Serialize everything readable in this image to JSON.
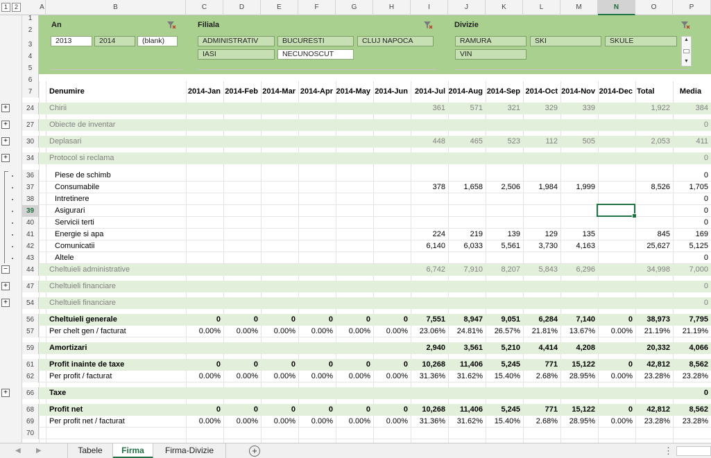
{
  "outline_levels": [
    "1",
    "2"
  ],
  "columns": [
    "A",
    "B",
    "C",
    "D",
    "E",
    "F",
    "G",
    "H",
    "I",
    "J",
    "K",
    "L",
    "M",
    "N",
    "O",
    "P"
  ],
  "selected_column": "N",
  "selected_row": "39",
  "slicers": {
    "an": {
      "title": "An",
      "items": [
        {
          "label": "2013",
          "on": true
        },
        {
          "label": "2014",
          "on": false
        },
        {
          "label": "(blank)",
          "on": true
        }
      ]
    },
    "filiala": {
      "title": "Filiala",
      "items": [
        {
          "label": "ADMINISTRATIV",
          "on": false
        },
        {
          "label": "BUCURESTI",
          "on": false
        },
        {
          "label": "CLUJ NAPOCA",
          "on": false
        },
        {
          "label": "IASI",
          "on": false
        },
        {
          "label": "NECUNOSCUT",
          "on": true
        }
      ]
    },
    "divizie": {
      "title": "Divizie",
      "items": [
        {
          "label": "RAMURA",
          "on": false
        },
        {
          "label": "SKI",
          "on": false
        },
        {
          "label": "SKULE",
          "on": false
        },
        {
          "label": "VIN",
          "on": false
        }
      ]
    }
  },
  "header": {
    "row": "7",
    "label": "Denumire",
    "months": [
      "2014-Jan",
      "2014-Feb",
      "2014-Mar",
      "2014-Apr",
      "2014-May",
      "2014-Jun",
      "2014-Jul",
      "2014-Aug",
      "2014-Sep",
      "2014-Oct",
      "2014-Nov",
      "2014-Dec"
    ],
    "total": "Total",
    "media": "Media"
  },
  "rows": [
    {
      "row": "24",
      "label": "Chirii",
      "type": "group",
      "plus": "+",
      "vals": [
        "",
        "",
        "",
        "",
        "",
        "",
        "361",
        "571",
        "321",
        "329",
        "339",
        "",
        "1,922",
        "384"
      ]
    },
    {
      "row": "27",
      "label": "Obiecte de inventar",
      "type": "group",
      "plus": "+",
      "vals": [
        "",
        "",
        "",
        "",
        "",
        "",
        "",
        "",
        "",
        "",
        "",
        "",
        "",
        "0"
      ]
    },
    {
      "row": "30",
      "label": "Deplasari",
      "type": "group",
      "plus": "+",
      "vals": [
        "",
        "",
        "",
        "",
        "",
        "",
        "448",
        "465",
        "523",
        "112",
        "505",
        "",
        "2,053",
        "411"
      ]
    },
    {
      "row": "34",
      "label": "Protocol si reclama",
      "type": "group",
      "plus": "+",
      "vals": [
        "",
        "",
        "",
        "",
        "",
        "",
        "",
        "",
        "",
        "",
        "",
        "",
        "",
        "0"
      ]
    },
    {
      "row": "36",
      "label": "Piese de schimb",
      "type": "sub",
      "vals": [
        "",
        "",
        "",
        "",
        "",
        "",
        "",
        "",
        "",
        "",
        "",
        "",
        "",
        "0"
      ]
    },
    {
      "row": "37",
      "label": "Consumabile",
      "type": "sub",
      "vals": [
        "",
        "",
        "",
        "",
        "",
        "",
        "378",
        "1,658",
        "2,506",
        "1,984",
        "1,999",
        "",
        "8,526",
        "1,705"
      ]
    },
    {
      "row": "38",
      "label": "Intretinere",
      "type": "sub",
      "vals": [
        "",
        "",
        "",
        "",
        "",
        "",
        "",
        "",
        "",
        "",
        "",
        "",
        "",
        "0"
      ]
    },
    {
      "row": "39",
      "label": "Asigurari",
      "type": "sub",
      "vals": [
        "",
        "",
        "",
        "",
        "",
        "",
        "",
        "",
        "",
        "",
        "",
        "",
        "",
        "0"
      ]
    },
    {
      "row": "40",
      "label": "Servicii terti",
      "type": "sub",
      "vals": [
        "",
        "",
        "",
        "",
        "",
        "",
        "",
        "",
        "",
        "",
        "",
        "",
        "",
        "0"
      ]
    },
    {
      "row": "41",
      "label": "Energie si apa",
      "type": "sub",
      "vals": [
        "",
        "",
        "",
        "",
        "",
        "",
        "224",
        "219",
        "139",
        "129",
        "135",
        "",
        "845",
        "169"
      ]
    },
    {
      "row": "42",
      "label": "Comunicatii",
      "type": "sub",
      "vals": [
        "",
        "",
        "",
        "",
        "",
        "",
        "6,140",
        "6,033",
        "5,561",
        "3,730",
        "4,163",
        "",
        "25,627",
        "5,125"
      ]
    },
    {
      "row": "43",
      "label": "Altele",
      "type": "sub",
      "vals": [
        "",
        "",
        "",
        "",
        "",
        "",
        "",
        "",
        "",
        "",
        "",
        "",
        "",
        "0"
      ]
    },
    {
      "row": "44",
      "label": "Cheltuieli administrative",
      "type": "group",
      "plus": "−",
      "vals": [
        "",
        "",
        "",
        "",
        "",
        "",
        "6,742",
        "7,910",
        "8,207",
        "5,843",
        "6,296",
        "",
        "34,998",
        "7,000"
      ]
    },
    {
      "row": "47",
      "label": "Cheltuieli financiare",
      "type": "group",
      "plus": "+",
      "vals": [
        "",
        "",
        "",
        "",
        "",
        "",
        "",
        "",
        "",
        "",
        "",
        "",
        "",
        "0"
      ]
    },
    {
      "row": "54",
      "label": "Cheltuieli financiare",
      "type": "group",
      "plus": "+",
      "vals": [
        "",
        "",
        "",
        "",
        "",
        "",
        "",
        "",
        "",
        "",
        "",
        "",
        "",
        "0"
      ]
    },
    {
      "row": "56",
      "label": "Cheltuieli generale",
      "type": "bold",
      "vals": [
        "0",
        "0",
        "0",
        "0",
        "0",
        "0",
        "7,551",
        "8,947",
        "9,051",
        "6,284",
        "7,140",
        "0",
        "38,973",
        "7,795"
      ]
    },
    {
      "row": "57",
      "label": "Per chelt gen / facturat",
      "type": "pct",
      "vals": [
        "0.00%",
        "0.00%",
        "0.00%",
        "0.00%",
        "0.00%",
        "0.00%",
        "23.06%",
        "24.81%",
        "26.57%",
        "21.81%",
        "13.67%",
        "0.00%",
        "21.19%",
        "21.19%"
      ]
    },
    {
      "row": "59",
      "label": "Amortizari",
      "type": "bold",
      "vals": [
        "",
        "",
        "",
        "",
        "",
        "",
        "2,940",
        "3,561",
        "5,210",
        "4,414",
        "4,208",
        "",
        "20,332",
        "4,066"
      ]
    },
    {
      "row": "61",
      "label": "Profit inainte de taxe",
      "type": "bold",
      "vals": [
        "0",
        "0",
        "0",
        "0",
        "0",
        "0",
        "10,268",
        "11,406",
        "5,245",
        "771",
        "15,122",
        "0",
        "42,812",
        "8,562"
      ]
    },
    {
      "row": "62",
      "label": "Per profit / facturat",
      "type": "pct",
      "vals": [
        "0.00%",
        "0.00%",
        "0.00%",
        "0.00%",
        "0.00%",
        "0.00%",
        "31.36%",
        "31.62%",
        "15.40%",
        "2.68%",
        "28.95%",
        "0.00%",
        "23.28%",
        "23.28%"
      ]
    },
    {
      "row": "66",
      "label": "Taxe",
      "type": "bold",
      "plus": "+",
      "vals": [
        "",
        "",
        "",
        "",
        "",
        "",
        "",
        "",
        "",
        "",
        "",
        "",
        "",
        "0"
      ]
    },
    {
      "row": "68",
      "label": "Profit net",
      "type": "bold",
      "vals": [
        "0",
        "0",
        "0",
        "0",
        "0",
        "0",
        "10,268",
        "11,406",
        "5,245",
        "771",
        "15,122",
        "0",
        "42,812",
        "8,562"
      ]
    },
    {
      "row": "69",
      "label": "Per profit net / facturat",
      "type": "pct",
      "vals": [
        "0.00%",
        "0.00%",
        "0.00%",
        "0.00%",
        "0.00%",
        "0.00%",
        "31.36%",
        "31.62%",
        "15.40%",
        "2.68%",
        "28.95%",
        "0.00%",
        "23.28%",
        "23.28%"
      ]
    },
    {
      "row": "70",
      "label": "",
      "type": "blank",
      "vals": []
    }
  ],
  "sheet_tabs": [
    "Tabele",
    "Firma",
    "Firma-Divizie"
  ],
  "active_tab": "Firma",
  "add_sheet": "+",
  "more_options": "⋮",
  "colors": {
    "slicer_band": "#a9d08e",
    "group_row": "#e2efda",
    "accent": "#217346"
  }
}
